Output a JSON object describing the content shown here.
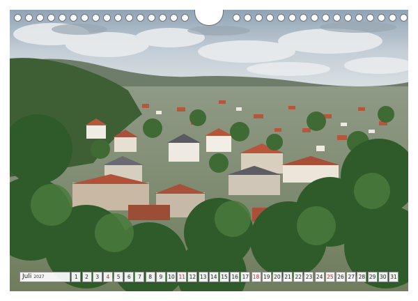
{
  "calendar": {
    "month": "Juli",
    "year": "2027",
    "days": [
      {
        "n": "1",
        "weekend": false
      },
      {
        "n": "2",
        "weekend": false
      },
      {
        "n": "3",
        "weekend": false
      },
      {
        "n": "4",
        "weekend": true
      },
      {
        "n": "5",
        "weekend": false
      },
      {
        "n": "6",
        "weekend": false
      },
      {
        "n": "7",
        "weekend": false
      },
      {
        "n": "8",
        "weekend": false
      },
      {
        "n": "9",
        "weekend": false
      },
      {
        "n": "10",
        "weekend": false
      },
      {
        "n": "11",
        "weekend": true
      },
      {
        "n": "12",
        "weekend": false
      },
      {
        "n": "13",
        "weekend": false
      },
      {
        "n": "14",
        "weekend": false
      },
      {
        "n": "15",
        "weekend": false
      },
      {
        "n": "16",
        "weekend": false
      },
      {
        "n": "17",
        "weekend": false
      },
      {
        "n": "18",
        "weekend": true
      },
      {
        "n": "19",
        "weekend": false
      },
      {
        "n": "20",
        "weekend": false
      },
      {
        "n": "21",
        "weekend": false
      },
      {
        "n": "22",
        "weekend": false
      },
      {
        "n": "23",
        "weekend": false
      },
      {
        "n": "24",
        "weekend": false
      },
      {
        "n": "25",
        "weekend": true
      },
      {
        "n": "26",
        "weekend": false
      },
      {
        "n": "27",
        "weekend": false
      },
      {
        "n": "28",
        "weekend": false
      },
      {
        "n": "29",
        "weekend": false
      },
      {
        "n": "30",
        "weekend": false
      },
      {
        "n": "31",
        "weekend": false
      }
    ]
  },
  "colors": {
    "weekend_text": "#c0282d",
    "sky": "#c9d3da",
    "forest": "#2f5a2a",
    "roof": "#b4573a"
  }
}
